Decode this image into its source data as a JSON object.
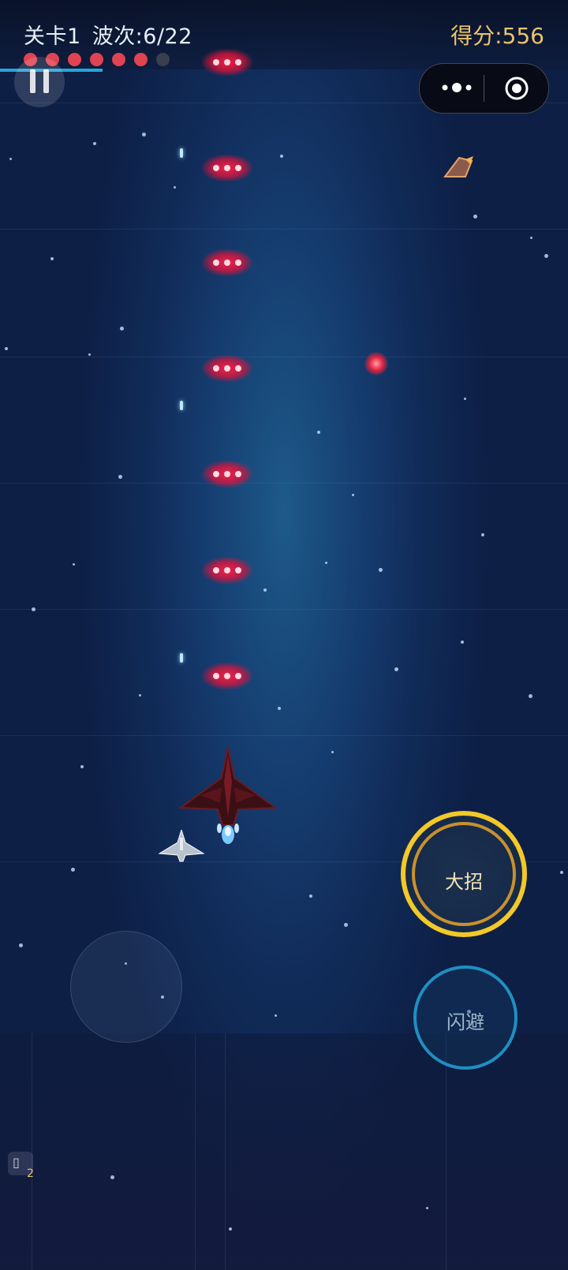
{
  "hud": {
    "level": "关卡1",
    "wave": "波次:6/22",
    "score": "得分:556",
    "wave_dots_filled": 6,
    "wave_dots_total": 7,
    "wave_progress_fraction": 0.18
  },
  "capsule": {
    "more_icon": "more-dots-icon",
    "target_icon": "target-circle-icon"
  },
  "controls": {
    "ultimate_label": "大招",
    "dodge_label": "闪避",
    "bomb_count": "2",
    "bomb_icon": "placeholder-glyph-icon"
  },
  "colors": {
    "score": "#e9c46a",
    "wave_dot_active": "#e04352",
    "ultimate_ring": "#f2c928",
    "dodge_ring": "#1f8fc2",
    "enemy_bullet": "#e0243e"
  }
}
